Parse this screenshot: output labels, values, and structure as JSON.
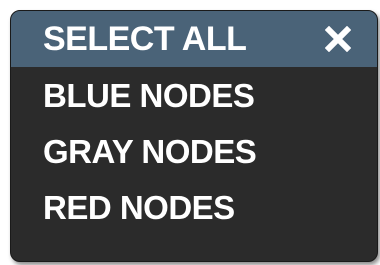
{
  "menu": {
    "header_label": "SELECT ALL",
    "close_icon": "close-icon",
    "items": [
      {
        "label": "BLUE NODES"
      },
      {
        "label": "GRAY NODES"
      },
      {
        "label": "RED NODES"
      }
    ]
  },
  "colors": {
    "menu_background": "#2b2b2b",
    "header_background": "#4a6378",
    "text": "#ffffff"
  }
}
